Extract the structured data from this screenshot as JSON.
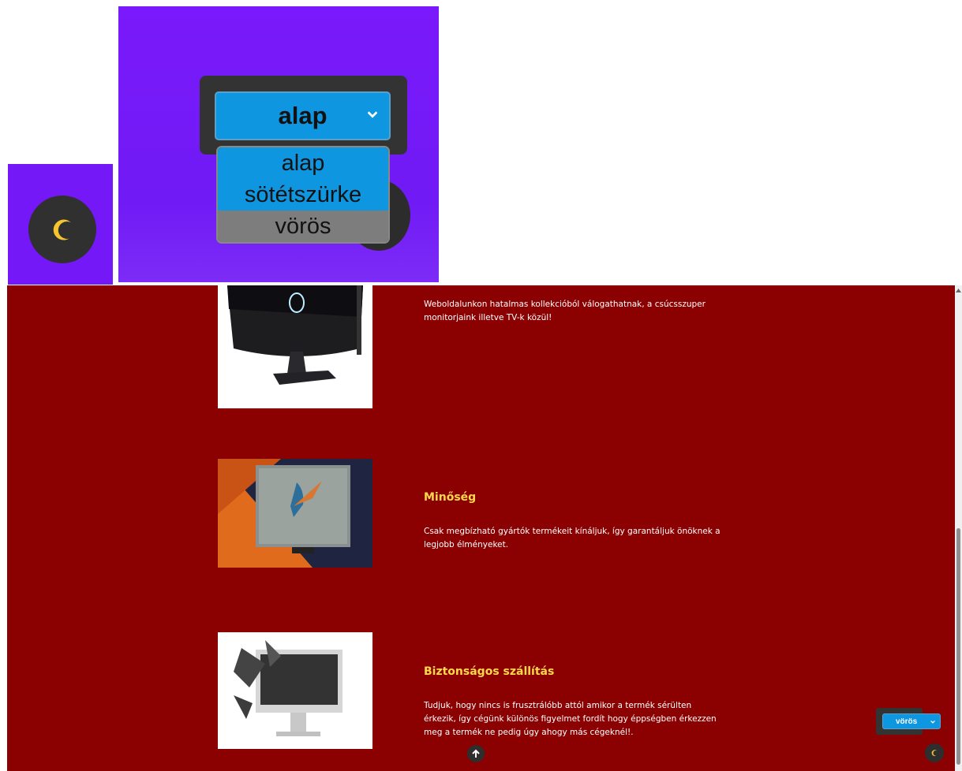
{
  "dropdown_zoom": {
    "selected": "alap",
    "options": [
      "alap",
      "sötétszürke",
      "vörös"
    ],
    "highlighted_option": "vörös"
  },
  "features": [
    {
      "title": "",
      "text": "Weboldalunkon hatalmas kollekcióból válogathatnak, a csúcsszuper monitorjaink illetve TV-k közül!"
    },
    {
      "title": "Minőség",
      "text": "Csak megbízható gyártók termékeit kínáljuk, így garantáljuk önöknek a legjobb élményeket."
    },
    {
      "title": "Biztonságos szállítás",
      "text": "Tudjuk, hogy nincs is frusztrálóbb attól amikor a termék sérülten érkezik, így cégünk különös figyelmet fordít hogy éppségben érkezzen meg a termék ne pedig úgy ahogy más cégeknél!."
    }
  ],
  "theme_selector": {
    "value": "vörös"
  },
  "icons": {
    "moon": "moon-icon",
    "scroll_top": "arrow-up-icon",
    "chevron": "chevron-down-icon"
  },
  "colors": {
    "page_background": "#8b0000",
    "accent_title": "#ffd84a",
    "select_blue": "#0e96e0",
    "collage_purple": "#7518f8",
    "moon_yellow": "#f6c431"
  }
}
